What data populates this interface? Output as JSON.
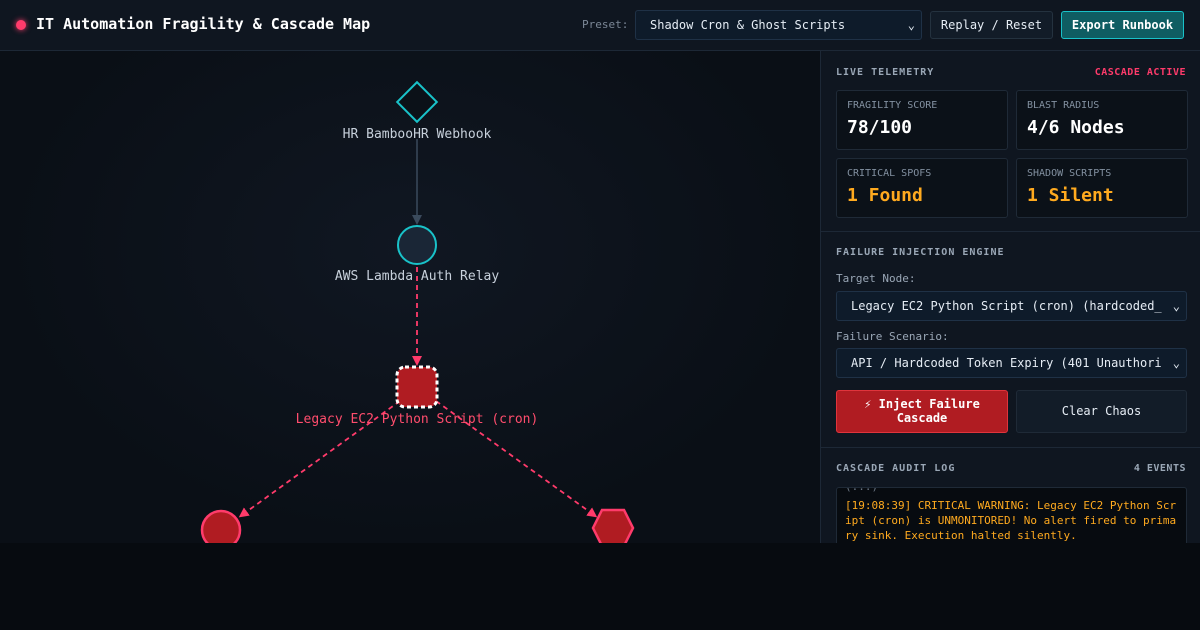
{
  "header": {
    "title": "IT Automation Fragility & Cascade Map",
    "preset_label": "Preset:",
    "preset_value": "Shadow Cron & Ghost Scripts",
    "replay_label": "Replay / Reset",
    "export_label": "Export Runbook"
  },
  "graph": {
    "nodes": [
      {
        "label": "HR BambooHR Webhook",
        "shape": "diamond",
        "state": "healthy"
      },
      {
        "label": "AWS Lambda Auth Relay",
        "shape": "circle",
        "state": "healthy"
      },
      {
        "label": "Legacy EC2 Python Script (cron)",
        "shape": "rounded-square",
        "state": "failed"
      },
      {
        "label": "",
        "shape": "circle",
        "state": "failed"
      },
      {
        "label": "",
        "shape": "hexagon",
        "state": "failed"
      }
    ]
  },
  "telemetry": {
    "title": "LIVE TELEMETRY",
    "status": "CASCADE ACTIVE",
    "metrics": [
      {
        "label": "FRAGILITY SCORE",
        "value": "78/100"
      },
      {
        "label": "BLAST RADIUS",
        "value": "4/6 Nodes"
      },
      {
        "label": "CRITICAL SPOFS",
        "value": "1 Found"
      },
      {
        "label": "SHADOW SCRIPTS",
        "value": "1 Silent"
      }
    ]
  },
  "injection": {
    "title": "FAILURE INJECTION ENGINE",
    "target_label": "Target Node:",
    "target_value": "Legacy EC2 Python Script (cron) (hardcoded_",
    "scenario_label": "Failure Scenario:",
    "scenario_value": "API / Hardcoded Token Expiry (401 Unauthori",
    "inject_label": "⚡ Inject Failure Cascade",
    "clear_label": "Clear Chaos"
  },
  "audit": {
    "title": "CASCADE AUDIT LOG",
    "count": "4 EVENTS",
    "entries": [
      "[19:08:39] CRITICAL WARNING: Legacy EC2 Python Script (cron) is UNMONITORED! No alert fired to primary sink. Execution halted silently."
    ]
  },
  "colors": {
    "accent": "#19c2c9",
    "danger": "#ff3b6b",
    "warning": "#ffaa1f",
    "failed_fill": "#b01c22"
  }
}
